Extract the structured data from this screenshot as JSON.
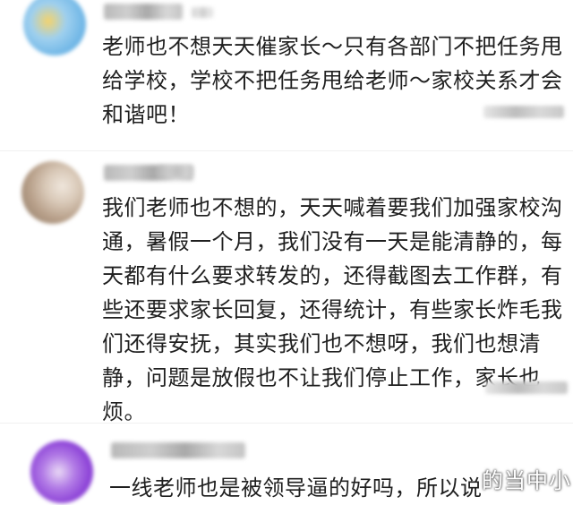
{
  "comments": [
    {
      "avatar_icon": "blurred-avatar-icon",
      "text": "老师也不想天天催家长～只有各部门不把任务甩给学校，学校不把任务甩给老师～家校关系才会和谐吧！"
    },
    {
      "avatar_icon": "blurred-avatar-icon",
      "text": "我们老师也不想的，天天喊着要我们加强家校沟通，暑假一个月，我们没有一天是能清静的，每天都有什么要求转发的，还得截图去工作群，有些还要求家长回复，还得统计，有些家长炸毛我们还得安抚，其实我们也不想呀，我们也想清静，问题是放假也不让我们停止工作，家长也烦。"
    },
    {
      "avatar_icon": "blurred-avatar-icon",
      "text": "一线老师也是被领导逼的好吗，所以说"
    }
  ],
  "watermark": "的当中小",
  "colors": {
    "text": "#1f1f1f",
    "background": "#ffffff",
    "avatar1": "#7ec0e8",
    "avatar2": "#c9b8a6",
    "avatar3": "#8a3fd6"
  }
}
